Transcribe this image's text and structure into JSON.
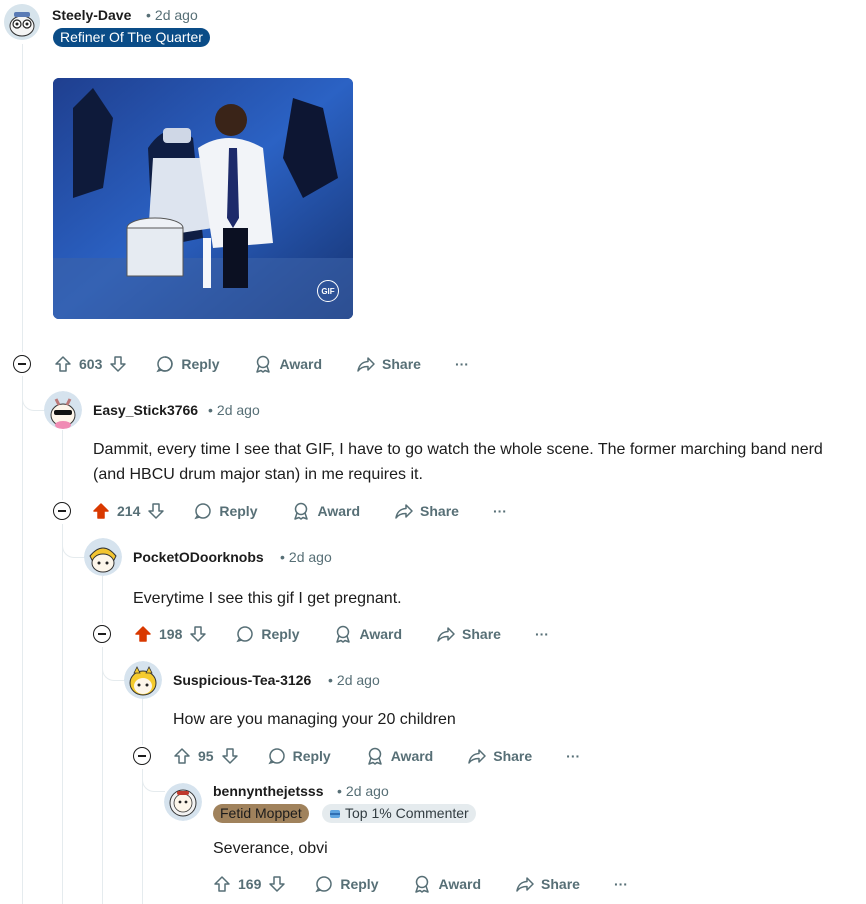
{
  "comments": [
    {
      "username": "Steely-Dave",
      "time": "2d ago",
      "flair": "Refiner Of The Quarter",
      "gif_badge": "GIF",
      "votes": "603",
      "reply": "Reply",
      "award": "Award",
      "share": "Share",
      "more": "···"
    },
    {
      "username": "Easy_Stick3766",
      "time": "2d ago",
      "text": "Dammit, every time I see that GIF, I have to go watch the whole scene. The former marching band nerd (and HBCU drum major stan) in me requires it.",
      "votes": "214",
      "upvoted": true,
      "reply": "Reply",
      "award": "Award",
      "share": "Share",
      "more": "···"
    },
    {
      "username": "PocketODoorknobs",
      "time": "2d ago",
      "text": "Everytime I see this gif I get pregnant.",
      "votes": "198",
      "upvoted": true,
      "reply": "Reply",
      "award": "Award",
      "share": "Share",
      "more": "···"
    },
    {
      "username": "Suspicious-Tea-3126",
      "time": "2d ago",
      "text": "How are you managing your 20 children",
      "votes": "95",
      "reply": "Reply",
      "award": "Award",
      "share": "Share",
      "more": "···"
    },
    {
      "username": "bennynthejetsss",
      "time": "2d ago",
      "flair": "Fetid Moppet",
      "badge": "Top 1% Commenter",
      "text": "Severance, obvi",
      "votes": "169",
      "reply": "Reply",
      "award": "Award",
      "share": "Share",
      "more": "···"
    }
  ],
  "colors": {
    "upvote_active": "#d93900",
    "meta": "#576f76",
    "flair_blue": "#0a4c87",
    "flair_brown": "#a0825c",
    "badge_bg": "#e5ebee",
    "thread_line": "#e5ebee"
  }
}
